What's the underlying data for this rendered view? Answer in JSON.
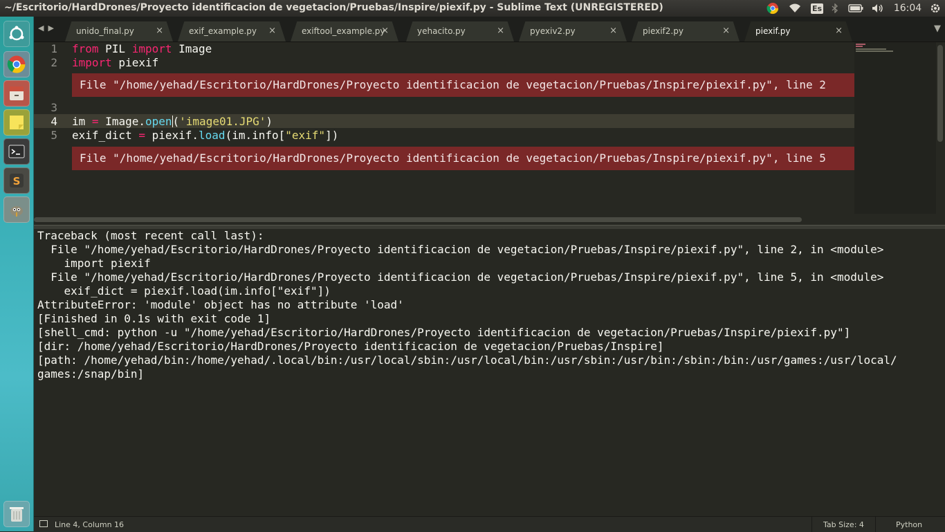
{
  "window": {
    "title": "~/Escritorio/HardDrones/Proyecto identificacion de vegetacion/Pruebas/Inspire/piexif.py - Sublime Text (UNREGISTERED)"
  },
  "tray": {
    "keyboard_layout": "Es",
    "clock": "16:04"
  },
  "tabs": [
    {
      "label": "unido_final.py",
      "close": "×"
    },
    {
      "label": "exif_example.py",
      "close": "×"
    },
    {
      "label": "exiftool_example.py",
      "close": "×"
    },
    {
      "label": "yehacito.py",
      "close": "×"
    },
    {
      "label": "pyexiv2.py",
      "close": "×"
    },
    {
      "label": "piexif2.py",
      "close": "×"
    },
    {
      "label": "piexif.py",
      "close": "×",
      "active": true
    }
  ],
  "tab_nav": {
    "prev": "◀",
    "next": "▶",
    "overflow": "▼"
  },
  "editor": {
    "line_numbers": [
      "1",
      "2",
      "3",
      "4",
      "5"
    ],
    "line1": {
      "kw1": "from",
      "mod": " PIL ",
      "kw2": "import",
      "name": " Image"
    },
    "line2": {
      "kw": "import",
      "name": " piexif"
    },
    "line4": {
      "a": "im ",
      "op": "=",
      "b": " Image.",
      "fn": "open",
      "c": "(",
      "str": "'image01.JPG'",
      "d": ")"
    },
    "line5": {
      "a": "exif_dict ",
      "op": "=",
      "b": " piexif.",
      "fn": "load",
      "c": "(im.info[",
      "str": "\"exif\"",
      "d": "])"
    },
    "phantom1": "File \"/home/yehad/Escritorio/HardDrones/Proyecto identificacion de vegetacion/Pruebas/Inspire/piexif.py\", line 2",
    "phantom2": "File \"/home/yehad/Escritorio/HardDrones/Proyecto identificacion de vegetacion/Pruebas/Inspire/piexif.py\", line 5"
  },
  "console": {
    "lines": [
      "Traceback (most recent call last):",
      "  File \"/home/yehad/Escritorio/HardDrones/Proyecto identificacion de vegetacion/Pruebas/Inspire/piexif.py\", line 2, in <module>",
      "    import piexif",
      "  File \"/home/yehad/Escritorio/HardDrones/Proyecto identificacion de vegetacion/Pruebas/Inspire/piexif.py\", line 5, in <module>",
      "    exif_dict = piexif.load(im.info[\"exif\"])",
      "AttributeError: 'module' object has no attribute 'load'",
      "[Finished in 0.1s with exit code 1]",
      "[shell_cmd: python -u \"/home/yehad/Escritorio/HardDrones/Proyecto identificacion de vegetacion/Pruebas/Inspire/piexif.py\"]",
      "[dir: /home/yehad/Escritorio/HardDrones/Proyecto identificacion de vegetacion/Pruebas/Inspire]",
      "[path: /home/yehad/bin:/home/yehad/.local/bin:/usr/local/sbin:/usr/local/bin:/usr/sbin:/usr/bin:/sbin:/bin:/usr/games:/usr/local/",
      "games:/snap/bin]"
    ]
  },
  "statusbar": {
    "position": "Line 4, Column 16",
    "tab_size": "Tab Size: 4",
    "syntax": "Python"
  },
  "colors": {
    "background": "#272822",
    "keyword": "#f92672",
    "function": "#66d9ef",
    "string": "#e6db74",
    "error_phantom": "#7a2828"
  }
}
